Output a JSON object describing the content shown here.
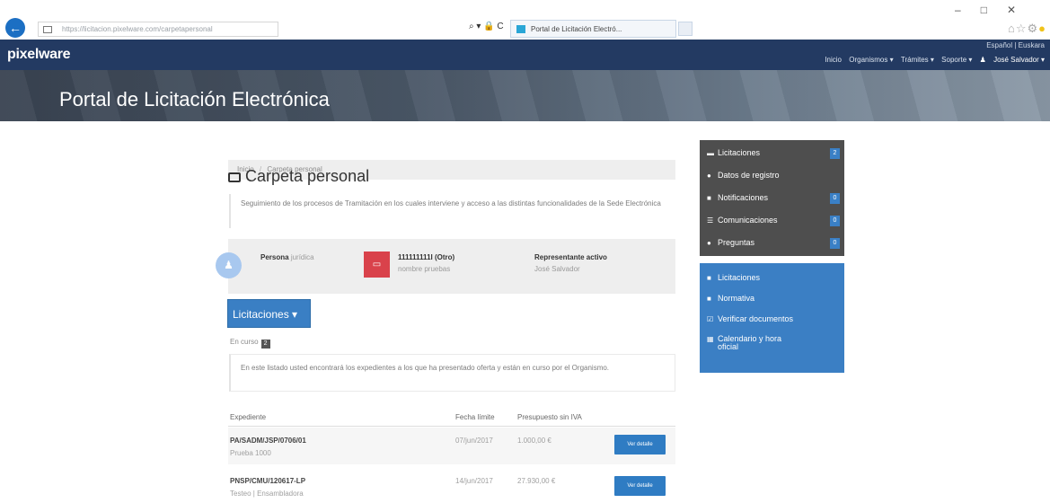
{
  "browser": {
    "url": "https://licitacion.pixelware.com/carpetapersonal",
    "tab_title": "Portal de Licitación Electró...",
    "address_tools": "⌕ ▾ 🔒 C"
  },
  "navbar": {
    "brand": "pixelware",
    "language": "Español | Euskara",
    "menu": [
      "Inicio",
      "Organismos ▾",
      "Trámites ▾",
      "Soporte ▾"
    ],
    "user": "José Salvador ▾"
  },
  "hero": {
    "title": "Portal de Licitación Electrónica"
  },
  "breadcrumb": {
    "home": "Inicio",
    "separator": "/",
    "current": "Carpeta personal"
  },
  "page": {
    "title": "Carpeta personal",
    "description": "Seguimiento de los procesos de Tramitación en los cuales interviene y acceso a las distintas funcionalidades de la Sede Electrónica"
  },
  "info": {
    "persona_label": "Persona",
    "persona_value": "jurídica",
    "entity_id": "111111111I (Otro)",
    "entity_name": "nombre pruebas",
    "rep_label": "Representante activo",
    "rep_value": "José Salvador"
  },
  "section": {
    "button": "Licitaciones ▾",
    "status": "En curso",
    "status_count": "2",
    "note": "En este listado usted encontrará los expedientes a los que ha presentado oferta y están en curso por el Organismo."
  },
  "table": {
    "headers": [
      "Expediente",
      "Fecha límite",
      "Presupuesto sin IVA"
    ],
    "rows": [
      {
        "code": "PA/SADM/JSP/0706/01",
        "name": "Prueba 1000",
        "date": "07/jun/2017",
        "budget": "1.000,00 €",
        "action": "Ver detalle"
      },
      {
        "code": "PNSP/CMU/120617-LP",
        "name": "Testeo | Ensambladora",
        "date": "14/jun/2017",
        "budget": "27.930,00 €",
        "action": "Ver detalle"
      }
    ]
  },
  "sidebar_dark": [
    {
      "icon": "inbox-icon",
      "glyph": "▬",
      "label": "Licitaciones",
      "count": "2"
    },
    {
      "icon": "user-icon",
      "glyph": "●",
      "label": "Datos de registro",
      "count": ""
    },
    {
      "icon": "envelope-icon",
      "glyph": "■",
      "label": "Notificaciones",
      "count": "0"
    },
    {
      "icon": "list-icon",
      "glyph": "☰",
      "label": "Comunicaciones",
      "count": "0"
    },
    {
      "icon": "question-icon",
      "glyph": "●",
      "label": "Preguntas",
      "count": "0"
    }
  ],
  "sidebar_blue": [
    {
      "icon": "file-icon",
      "glyph": "■",
      "label": "Licitaciones"
    },
    {
      "icon": "book-icon",
      "glyph": "■",
      "label": "Normativa"
    },
    {
      "icon": "check-icon",
      "glyph": "☑",
      "label": "Verificar documentos"
    },
    {
      "icon": "calendar-icon",
      "glyph": "▦",
      "label": "Calendario y hora oficial"
    }
  ],
  "colors": {
    "navbar": "#233a62",
    "accent": "#3a7fc4",
    "sidebar_dark": "#4e4e4e",
    "danger": "#d9424b"
  }
}
